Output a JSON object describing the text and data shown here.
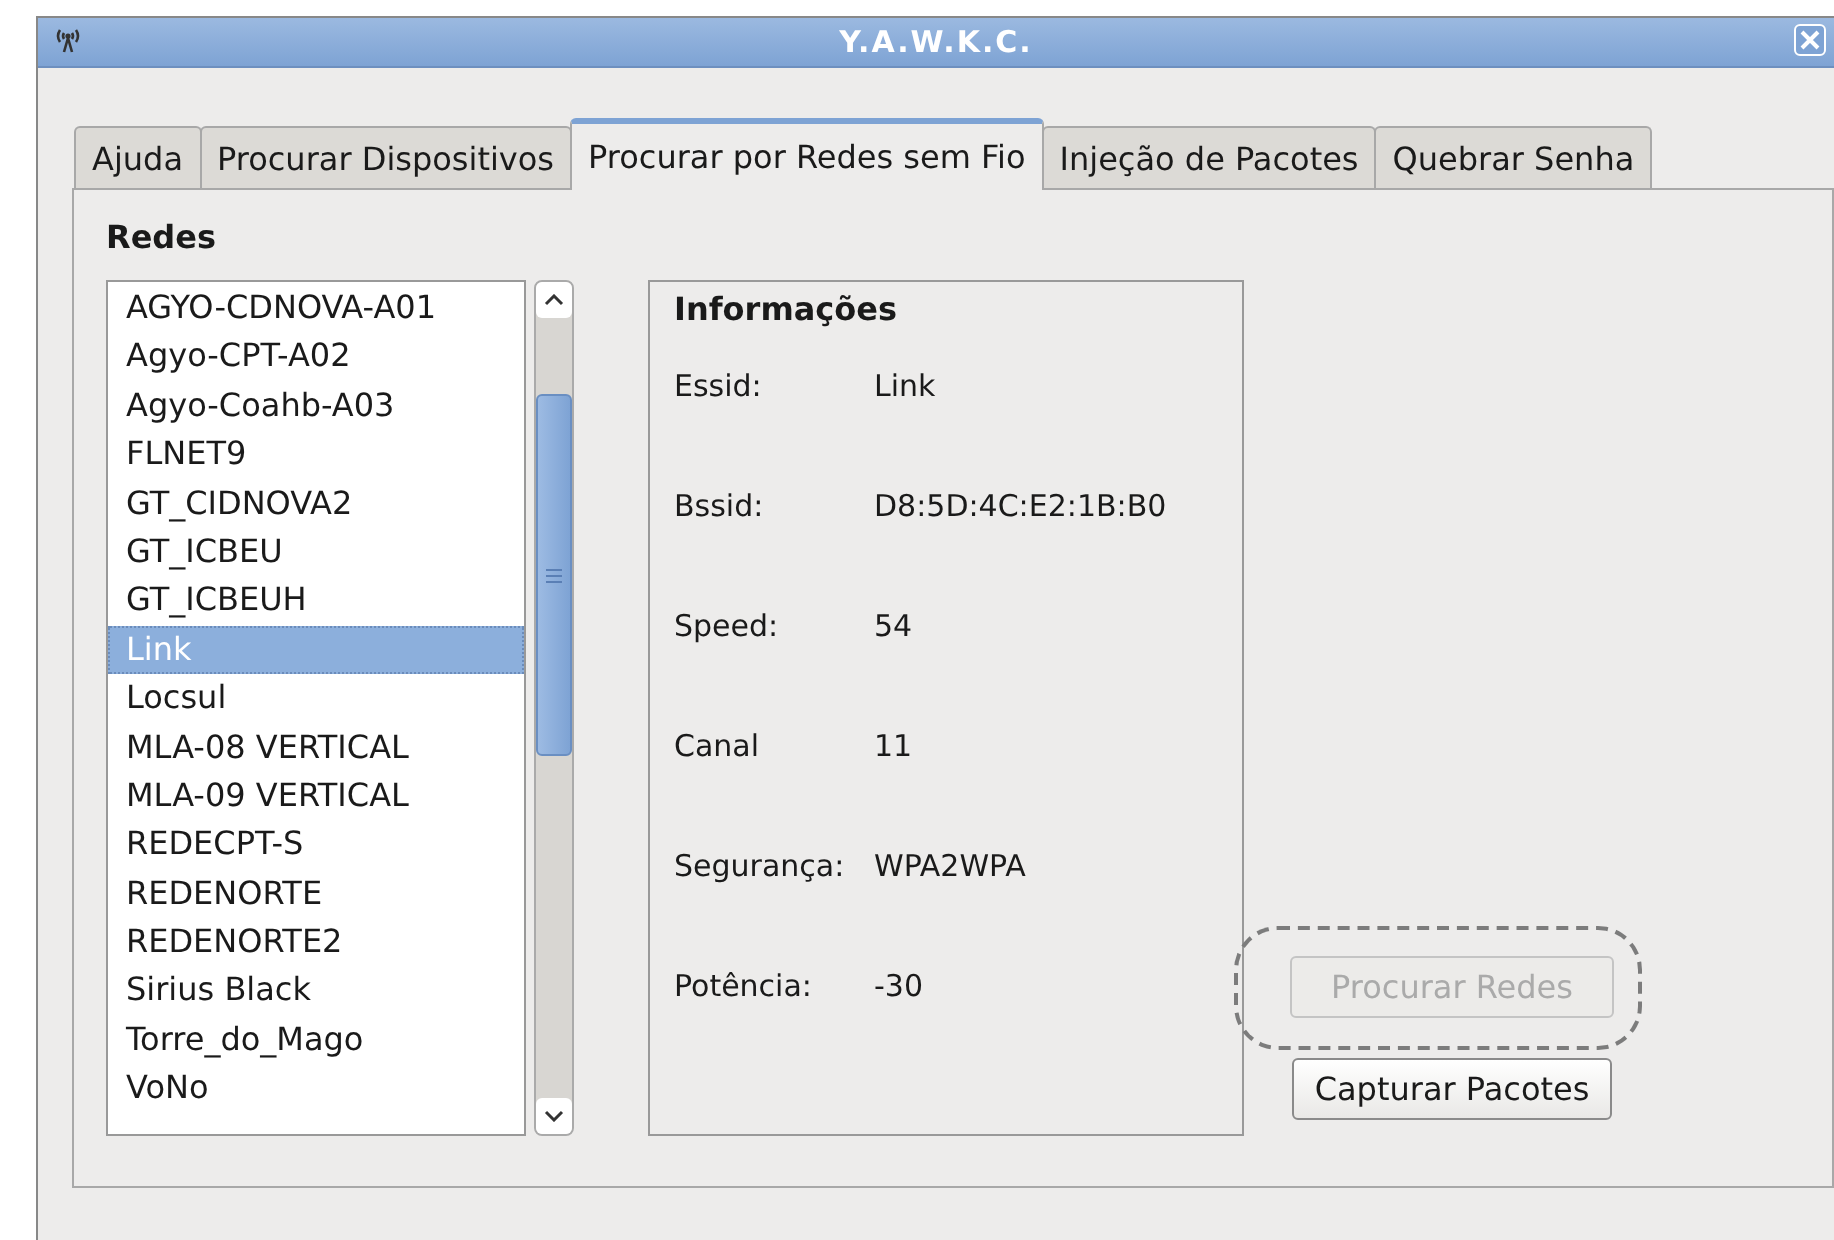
{
  "window": {
    "title": "Y.A.W.K.C."
  },
  "tabs": [
    {
      "label": "Ajuda",
      "selected": false
    },
    {
      "label": "Procurar Dispositivos",
      "selected": false
    },
    {
      "label": "Procurar por Redes sem Fio",
      "selected": true
    },
    {
      "label": "Injeção de Pacotes",
      "selected": false
    },
    {
      "label": "Quebrar Senha",
      "selected": false
    }
  ],
  "networks_heading": "Redes",
  "networks": [
    {
      "name": "AGYO-CDNOVA-A01",
      "selected": false
    },
    {
      "name": "Agyo-CPT-A02",
      "selected": false
    },
    {
      "name": "Agyo-Coahb-A03",
      "selected": false
    },
    {
      "name": "FLNET9",
      "selected": false
    },
    {
      "name": "GT_CIDNOVA2",
      "selected": false
    },
    {
      "name": "GT_ICBEU",
      "selected": false
    },
    {
      "name": "GT_ICBEUH",
      "selected": false
    },
    {
      "name": "Link",
      "selected": true
    },
    {
      "name": "Locsul",
      "selected": false
    },
    {
      "name": "MLA-08 VERTICAL",
      "selected": false
    },
    {
      "name": "MLA-09 VERTICAL",
      "selected": false
    },
    {
      "name": "REDECPT-S",
      "selected": false
    },
    {
      "name": "REDENORTE",
      "selected": false
    },
    {
      "name": "REDENORTE2",
      "selected": false
    },
    {
      "name": "Sirius Black",
      "selected": false
    },
    {
      "name": "Torre_do_Mago",
      "selected": false
    },
    {
      "name": "VoNo",
      "selected": false
    }
  ],
  "info": {
    "title": "Informações",
    "fields": [
      {
        "label": "Essid:",
        "value": "Link"
      },
      {
        "label": "Bssid:",
        "value": "D8:5D:4C:E2:1B:B0"
      },
      {
        "label": "Speed:",
        "value": "54"
      },
      {
        "label": "Canal",
        "value": "11"
      },
      {
        "label": "Segurança:",
        "value": "WPA2WPA"
      },
      {
        "label": "Potência:",
        "value": "-30"
      }
    ]
  },
  "buttons": [
    {
      "label": "Procurar Redes",
      "disabled": true,
      "circled": true
    },
    {
      "label": "Capturar Pacotes",
      "disabled": false,
      "circled": false
    }
  ]
}
